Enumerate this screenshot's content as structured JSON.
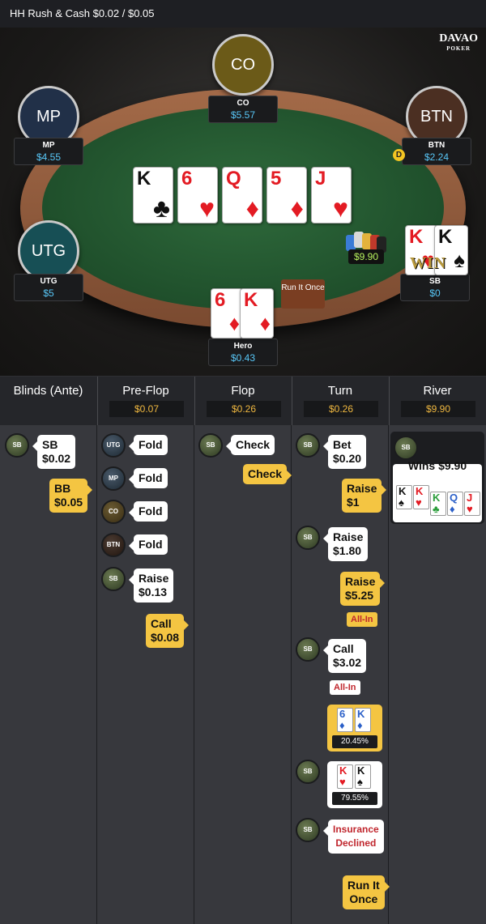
{
  "header": {
    "title": "HH  Rush & Cash $0.02 / $0.05"
  },
  "logo": {
    "brand": "DAVAO",
    "sub": "POKER"
  },
  "seats": [
    {
      "id": "CO",
      "name": "CO",
      "stack": "$5.57",
      "color": "#6b5a18"
    },
    {
      "id": "MP",
      "name": "MP",
      "stack": "$4.55",
      "color": "#213048"
    },
    {
      "id": "BTN",
      "name": "BTN",
      "stack": "$2.24",
      "color": "#4b2f22"
    },
    {
      "id": "UTG",
      "name": "UTG",
      "stack": "$5",
      "color": "#174f55"
    },
    {
      "id": "SB",
      "name": "SB",
      "stack": "$0"
    },
    {
      "id": "Hero",
      "name": "Hero",
      "stack": "$0.43"
    }
  ],
  "board": [
    {
      "rank": "K",
      "suit": "♣",
      "color": "blk"
    },
    {
      "rank": "6",
      "suit": "♥",
      "color": "red"
    },
    {
      "rank": "Q",
      "suit": "♦",
      "color": "red"
    },
    {
      "rank": "5",
      "suit": "♦",
      "color": "red"
    },
    {
      "rank": "J",
      "suit": "♥",
      "color": "red"
    }
  ],
  "hero_cards": [
    {
      "rank": "6",
      "suit": "♦",
      "color": "red"
    },
    {
      "rank": "K",
      "suit": "♦",
      "color": "red"
    }
  ],
  "sb_cards": [
    {
      "rank": "K",
      "suit": "♥",
      "color": "red"
    },
    {
      "rank": "K",
      "suit": "♠",
      "color": "blk"
    }
  ],
  "dealer_label": "D",
  "pot": "$9.90",
  "run_it_once_button": "Run It Once",
  "win_stamp": "WIN",
  "streets": [
    {
      "name": "Blinds (Ante)",
      "pot": ""
    },
    {
      "name": "Pre-Flop",
      "pot": "$0.07"
    },
    {
      "name": "Flop",
      "pot": "$0.26"
    },
    {
      "name": "Turn",
      "pot": "$0.26"
    },
    {
      "name": "River",
      "pot": "$9.90"
    }
  ],
  "actions": {
    "blinds": {
      "sb_avatar": "SB",
      "sb": "SB\n$0.02",
      "bb": "BB\n$0.05"
    },
    "preflop": {
      "utg": "UTG",
      "utg_act": "Fold",
      "mp": "MP",
      "mp_act": "Fold",
      "co": "CO",
      "co_act": "Fold",
      "btn": "BTN",
      "btn_act": "Fold",
      "sb": "SB",
      "sb_act": "Raise\n$0.13",
      "hero_act": "Call\n$0.08"
    },
    "flop": {
      "sb": "SB",
      "sb_act": "Check",
      "hero_act": "Check"
    },
    "turn": {
      "sb1": "SB",
      "bet": "Bet\n$0.20",
      "raise1": "Raise\n$1",
      "sb2": "SB",
      "raise2": "Raise\n$1.80",
      "raise3": "Raise\n$5.25",
      "allin1": "All-In",
      "sb3": "SB",
      "call": "Call\n$3.02",
      "allin2": "All-In",
      "ins_hero_pct": "20.45%",
      "sb4": "SB",
      "ins_sb_pct": "79.55%",
      "sb5": "SB",
      "ins_declined": "Insurance\nDeclined",
      "run_once": "Run It\nOnce"
    },
    "river": {
      "sb": "SB",
      "wins": "Wins $9.90"
    }
  },
  "river_hand": [
    {
      "rank": "K",
      "suit": "♠",
      "color": "blk"
    },
    {
      "rank": "K",
      "suit": "♥",
      "color": "red"
    },
    {
      "rank": "K",
      "suit": "♣",
      "color": "#2a9d3a"
    },
    {
      "rank": "Q",
      "suit": "♦",
      "color": "#2a5fc8"
    },
    {
      "rank": "J",
      "suit": "♥",
      "color": "red"
    }
  ]
}
